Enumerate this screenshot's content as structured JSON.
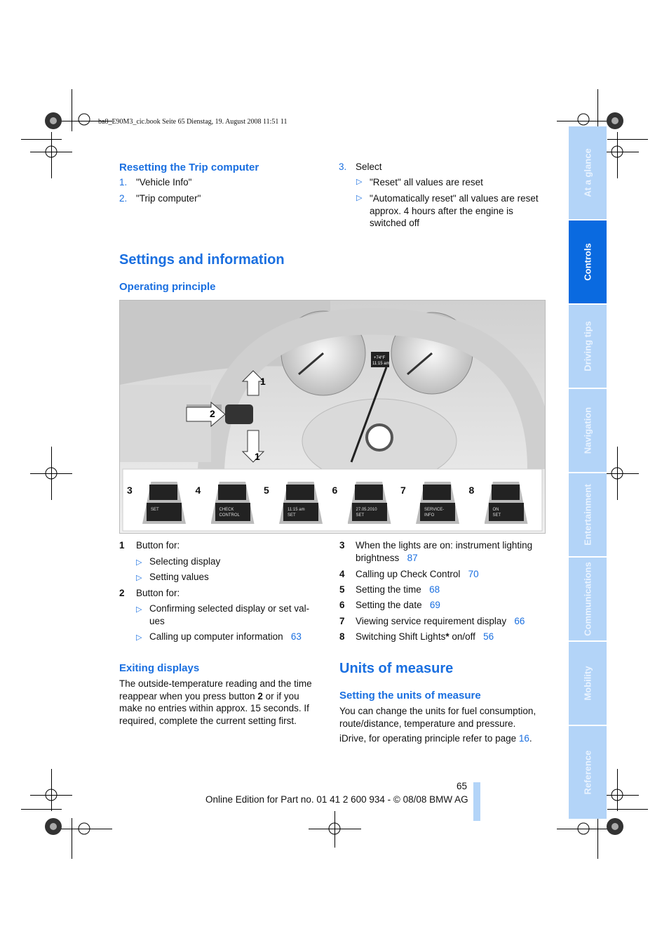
{
  "header": {
    "print_line": "ba8_E90M3_cic.book  Seite 65  Dienstag, 19. August 2008  11:51 11"
  },
  "sidebar": {
    "tabs": [
      {
        "label": "At a glance",
        "active": false
      },
      {
        "label": "Controls",
        "active": true
      },
      {
        "label": "Driving tips",
        "active": false
      },
      {
        "label": "Navigation",
        "active": false
      },
      {
        "label": "Entertainment",
        "active": false
      },
      {
        "label": "Communications",
        "active": false
      },
      {
        "label": "Mobility",
        "active": false
      },
      {
        "label": "Reference",
        "active": false
      }
    ]
  },
  "reset": {
    "title": "Resetting the Trip computer",
    "steps": [
      {
        "n": "1.",
        "text": "\"Vehicle Info\""
      },
      {
        "n": "2.",
        "text": "\"Trip computer\""
      },
      {
        "n": "3.",
        "text": "Select"
      }
    ],
    "options": [
      "\"Reset\" all values are reset",
      "\"Automatically reset\" all values are reset approx. 4 hours after the engine is switched off"
    ]
  },
  "settings": {
    "title": "Settings and information",
    "subtitle": "Operating principle"
  },
  "figure": {
    "callouts": [
      "1",
      "2",
      "1",
      "3",
      "4",
      "5",
      "6",
      "7",
      "8"
    ],
    "displays": [
      {
        "n": "3",
        "line1": "",
        "line2": "SET"
      },
      {
        "n": "4",
        "line1": "CHECK",
        "line2": "CONTROL"
      },
      {
        "n": "5",
        "line1": "11:15 am",
        "line2": "SET"
      },
      {
        "n": "6",
        "line1": "27.05.2010",
        "line2": "SET"
      },
      {
        "n": "7",
        "line1": "SERVICE-",
        "line2": "INFO"
      },
      {
        "n": "8",
        "line1": "ON",
        "line2": "SET"
      }
    ],
    "cluster_readout": [
      "+74°F",
      "11:15 am"
    ]
  },
  "legend_left": [
    {
      "n": "1",
      "text": "Button for:",
      "subs": [
        {
          "text": "Selecting display"
        },
        {
          "text": "Setting values"
        }
      ]
    },
    {
      "n": "2",
      "text": "Button for:",
      "subs": [
        {
          "text": "Confirming selected display or set val-",
          "text2": "ues"
        },
        {
          "text": "Calling up computer information",
          "page": "63"
        }
      ]
    }
  ],
  "legend_right": [
    {
      "n": "3",
      "text": "When the lights are on: instrument lighting",
      "text2": "brightness",
      "page": "87"
    },
    {
      "n": "4",
      "text": "Calling up Check Control",
      "page": "70"
    },
    {
      "n": "5",
      "text": "Setting the time",
      "page": "68"
    },
    {
      "n": "6",
      "text": "Setting the date",
      "page": "69"
    },
    {
      "n": "7",
      "text": "Viewing service requirement display",
      "page": "66"
    },
    {
      "n": "8",
      "text": "Switching Shift Lights",
      "star": "*",
      "text3": " on/off",
      "page": "56"
    }
  ],
  "exiting": {
    "title": "Exiting displays",
    "lines": [
      "The outside-temperature reading and the time",
      "reappear when you press button ",
      "2",
      " or if you",
      "make no entries within approx. 15 seconds. If",
      "required, complete the current setting first."
    ]
  },
  "units": {
    "title": "Units of measure",
    "subtitle": "Setting the units of measure",
    "lines": [
      "You can change the units for fuel consumption,",
      "route/distance, temperature and pressure."
    ],
    "idrive": "iDrive, for operating principle refer to page ",
    "idrive_page": "16",
    "idrive_end": "."
  },
  "footer": {
    "page": "65",
    "edition": "Online Edition for Part no. 01 41 2 600 934 - © 08/08 BMW AG"
  },
  "colors": {
    "accent": "#1a6fe0",
    "tab_active": "#0a6ae0",
    "tab": "#b3d4f8",
    "subheading_light": "#6fa8e8"
  }
}
